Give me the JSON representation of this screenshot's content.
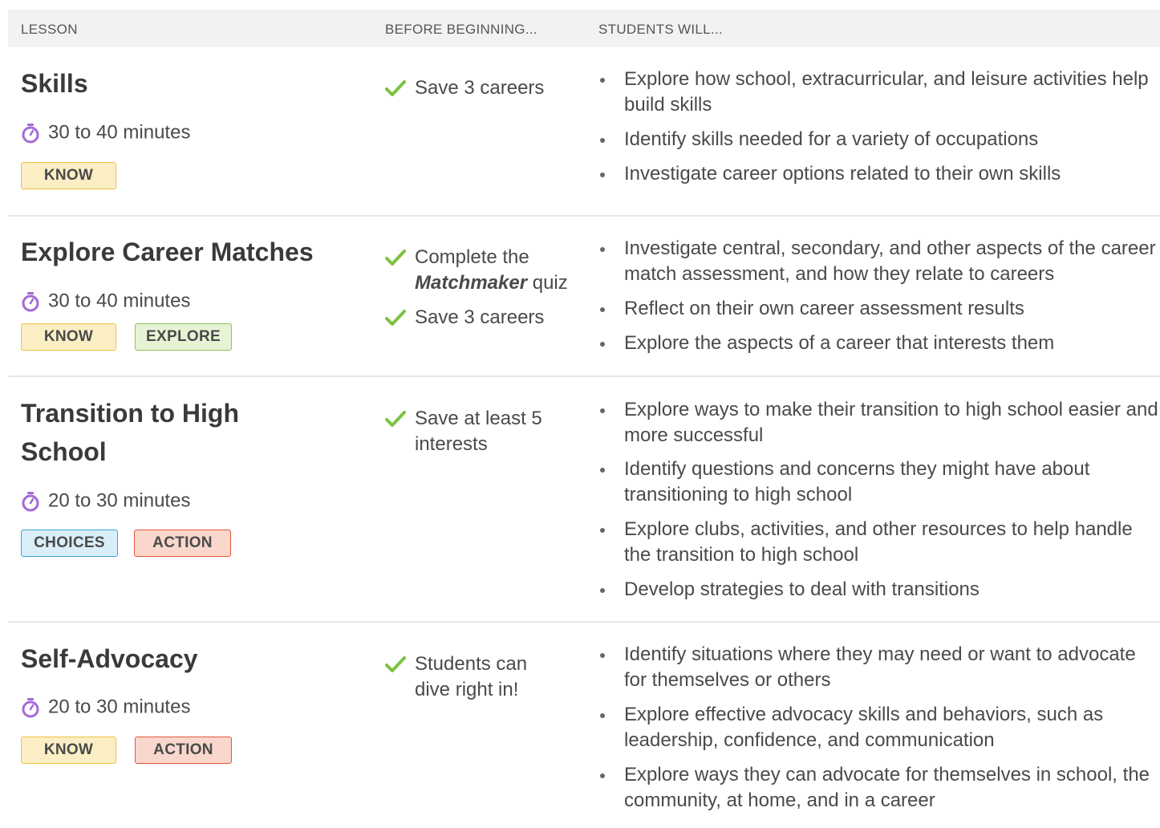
{
  "header": {
    "lesson": "LESSON",
    "before": "BEFORE BEGINNING...",
    "students": "STUDENTS WILL..."
  },
  "colors": {
    "check": "#7cc242",
    "stopwatch": "#a46ad6",
    "know_bg": "#fbeec4",
    "explore_bg": "#e6f3d4",
    "choices_bg": "#d9eef8",
    "action_bg": "#f9d7cc"
  },
  "icons": {
    "check": "checkmark-icon",
    "time": "stopwatch-icon"
  },
  "lessons": [
    {
      "title": "Skills",
      "time": "30 to 40 minutes",
      "tags": [
        "KNOW"
      ],
      "prereqs": [
        "Save 3 careers"
      ],
      "outcomes": [
        "Explore how school, extracurricular, and leisure activities help build skills",
        "Identify skills needed for a variety of occupations",
        "Investigate career options related to their own skills"
      ]
    },
    {
      "title": "Explore Career Matches",
      "time": "30 to 40 minutes",
      "tags": [
        "KNOW",
        "EXPLORE"
      ],
      "prereqs": [
        {
          "line1": "Complete the",
          "emph": "Matchmaker",
          "line2_rest": " quiz"
        },
        "Save 3 careers"
      ],
      "outcomes": [
        "Investigate central, secondary, and other aspects of the career match assessment, and how they relate to careers",
        "Reflect on their own career assessment results",
        "Explore the aspects of a career that interests them"
      ]
    },
    {
      "title": "Transition to High School",
      "time": "20 to 30 minutes",
      "tags": [
        "CHOICES",
        "ACTION"
      ],
      "prereqs": [
        "Save at least 5 interests"
      ],
      "outcomes": [
        "Explore ways to make their transition to high school easier and more successful",
        "Identify questions and concerns they might have about transitioning to high school",
        "Explore clubs, activities, and other resources to help handle the transition to high school",
        "Develop strategies to deal with transitions"
      ]
    },
    {
      "title": "Self-Advocacy",
      "time": "20 to 30 minutes",
      "tags": [
        "KNOW",
        "ACTION"
      ],
      "prereqs": [
        "Students can dive right in!"
      ],
      "outcomes": [
        "Identify situations where they may need or want to advocate for themselves or others",
        "Explore effective advocacy skills and behaviors, such as leadership, confidence, and communication",
        "Explore ways they can advocate for themselves in school, the community, at home, and in a career"
      ]
    }
  ]
}
